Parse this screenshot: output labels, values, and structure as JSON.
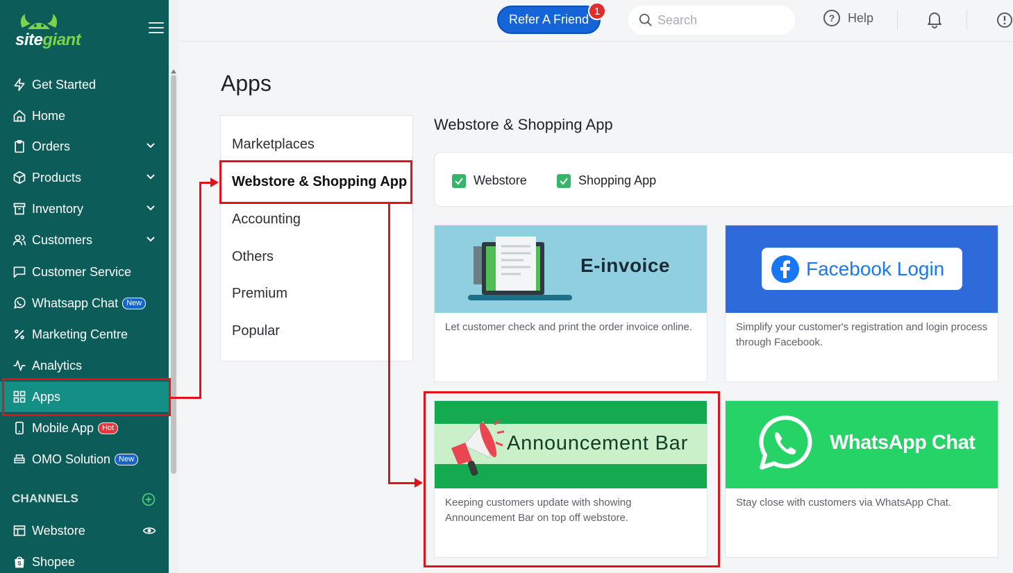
{
  "brand": {
    "logo_text_site": "site",
    "logo_text_giant": "giant"
  },
  "sidebar": {
    "items": [
      {
        "label": "Get Started",
        "icon": "lightning-icon"
      },
      {
        "label": "Home",
        "icon": "home-icon"
      },
      {
        "label": "Orders",
        "icon": "clipboard-icon",
        "expandable": true
      },
      {
        "label": "Products",
        "icon": "box-icon",
        "expandable": true
      },
      {
        "label": "Inventory",
        "icon": "inventory-icon",
        "expandable": true
      },
      {
        "label": "Customers",
        "icon": "users-icon",
        "expandable": true
      },
      {
        "label": "Customer Service",
        "icon": "chat-icon"
      },
      {
        "label": "Whatsapp Chat",
        "icon": "whatsapp-icon",
        "badge": "New"
      },
      {
        "label": "Marketing Centre",
        "icon": "percent-icon"
      },
      {
        "label": "Analytics",
        "icon": "pulse-icon"
      },
      {
        "label": "Apps",
        "icon": "grid-icon",
        "active": true
      },
      {
        "label": "Mobile App",
        "icon": "mobile-icon",
        "badge": "Hot"
      },
      {
        "label": "OMO Solution",
        "icon": "store-icon",
        "badge": "New"
      }
    ],
    "channels_label": "CHANNELS",
    "channels": [
      {
        "label": "Webstore",
        "icon": "webstore-icon"
      },
      {
        "label": "Shopee",
        "icon": "shopee-icon"
      }
    ]
  },
  "topbar": {
    "refer_label": "Refer A Friend",
    "refer_count": "1",
    "search_placeholder": "Search",
    "help_label": "Help"
  },
  "page": {
    "title": "Apps",
    "categories": [
      "Marketplaces",
      "Webstore & Shopping App",
      "Accounting",
      "Others",
      "Premium",
      "Popular"
    ],
    "selected_category": "Webstore & Shopping App",
    "section_title": "Webstore & Shopping App",
    "filters": [
      {
        "label": "Webstore",
        "checked": true
      },
      {
        "label": "Shopping App",
        "checked": true
      }
    ],
    "apps": [
      {
        "name": "E-invoice",
        "description": "Let customer check and print the order invoice online."
      },
      {
        "name": "Facebook Login",
        "description": "Simplify your customer's registration and login process through Facebook."
      },
      {
        "name": "Announcement Bar",
        "description": "Keeping customers update with showing Announcement Bar on top off webstore."
      },
      {
        "name": "WhatsApp Chat",
        "description": "Stay close with customers via WhatsApp Chat."
      }
    ]
  },
  "colors": {
    "sidebar_bg": "#0c5c5a",
    "sidebar_active": "#138f85",
    "primary_blue": "#1565d8",
    "annotation_red": "#e3121a",
    "check_green": "#34b56a"
  }
}
